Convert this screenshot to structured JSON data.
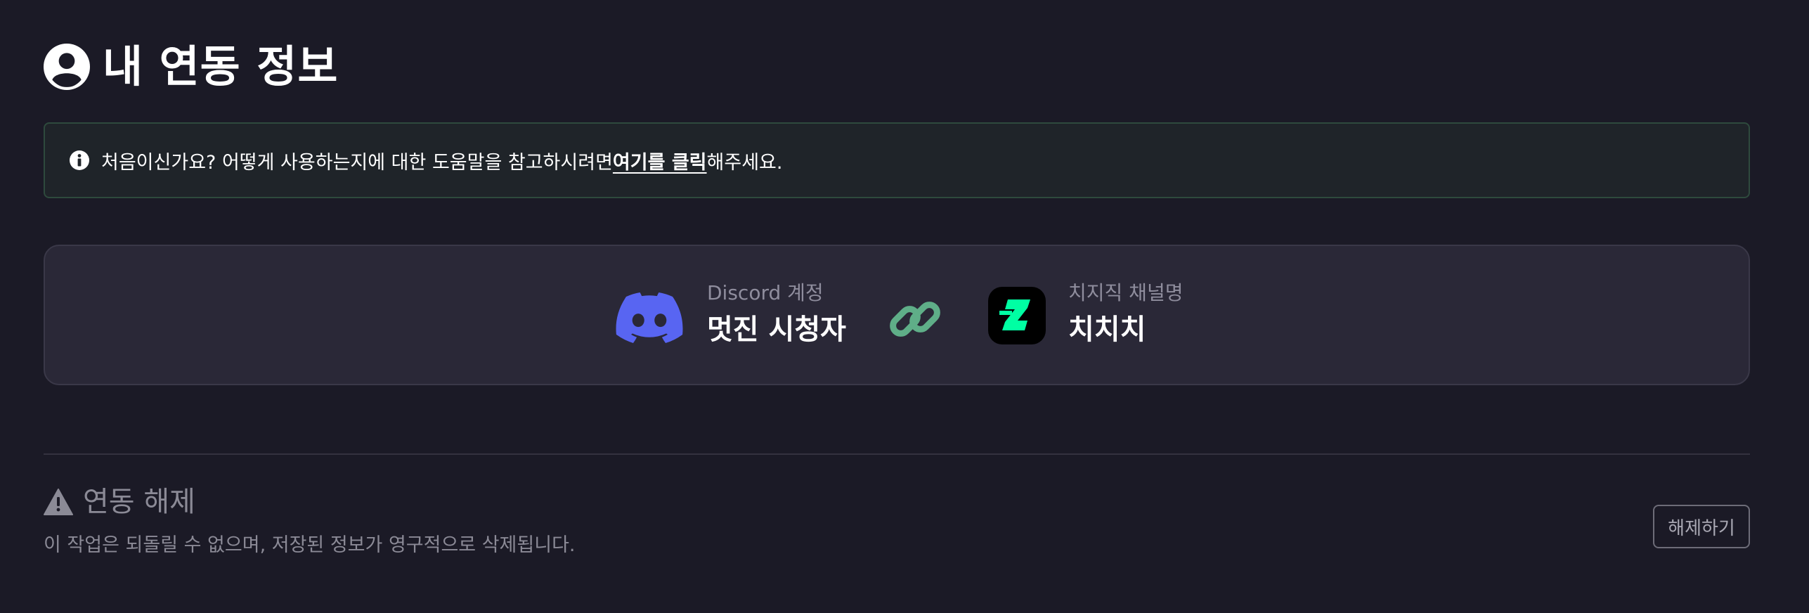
{
  "page": {
    "title": "내 연동 정보",
    "title_icon": "user-circle-icon"
  },
  "alert": {
    "icon": "info-circle-icon",
    "text_before": "처음이신가요? 어떻게 사용하는지에 대한 도움말을 참고하시려면 ",
    "link_text": "여기를 클릭",
    "text_after": "해주세요.",
    "border_color": "#2e4a3d"
  },
  "link_card": {
    "discord": {
      "logo": "discord-logo",
      "label": "Discord 계정",
      "name": "멋진 시청자",
      "color": "#5865f2"
    },
    "link_icon": "chain-link-icon",
    "link_color": "#5fae88",
    "chzzk": {
      "logo": "chzzk-logo",
      "label": "치지직 채널명",
      "name": "치치치",
      "color": "#00ffa3"
    }
  },
  "danger_zone": {
    "icon": "warning-triangle-icon",
    "title": "연동 해제",
    "description": "이 작업은 되돌릴 수 없으며, 저장된 정보가 영구적으로 삭제됩니다.",
    "button_label": "해제하기"
  }
}
